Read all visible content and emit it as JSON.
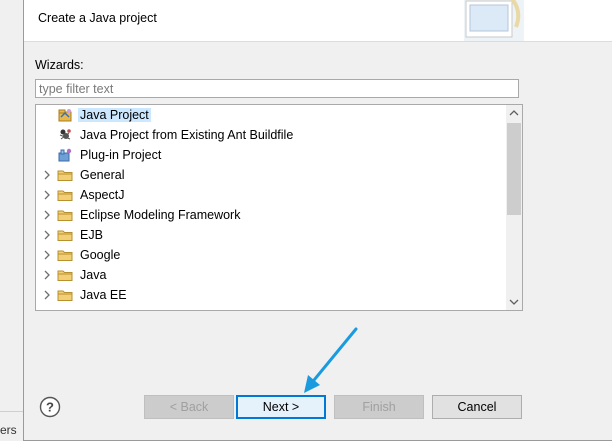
{
  "background_fragment": "ers",
  "header": {
    "description": "Create a Java project"
  },
  "wizards": {
    "label": "Wizards:",
    "filter_placeholder": "type filter text",
    "items": [
      {
        "label": "Java Project",
        "icon": "java-project-icon",
        "expandable": false,
        "selected": true
      },
      {
        "label": "Java Project from Existing Ant Buildfile",
        "icon": "ant-buildfile-icon",
        "expandable": false,
        "selected": false
      },
      {
        "label": "Plug-in Project",
        "icon": "plugin-project-icon",
        "expandable": false,
        "selected": false
      },
      {
        "label": "General",
        "icon": "folder-icon",
        "expandable": true,
        "selected": false
      },
      {
        "label": "AspectJ",
        "icon": "folder-icon",
        "expandable": true,
        "selected": false
      },
      {
        "label": "Eclipse Modeling Framework",
        "icon": "folder-icon",
        "expandable": true,
        "selected": false
      },
      {
        "label": "EJB",
        "icon": "folder-icon",
        "expandable": true,
        "selected": false
      },
      {
        "label": "Google",
        "icon": "folder-icon",
        "expandable": true,
        "selected": false
      },
      {
        "label": "Java",
        "icon": "folder-icon",
        "expandable": true,
        "selected": false
      },
      {
        "label": "Java EE",
        "icon": "folder-icon",
        "expandable": true,
        "selected": false
      }
    ]
  },
  "buttons": {
    "back": "< Back",
    "next": "Next >",
    "finish": "Finish",
    "cancel": "Cancel"
  },
  "colors": {
    "selection": "#cce8ff",
    "default_button_border": "#0078d7",
    "annotation_arrow": "#1a9be0",
    "folder": "#e8b84a"
  }
}
